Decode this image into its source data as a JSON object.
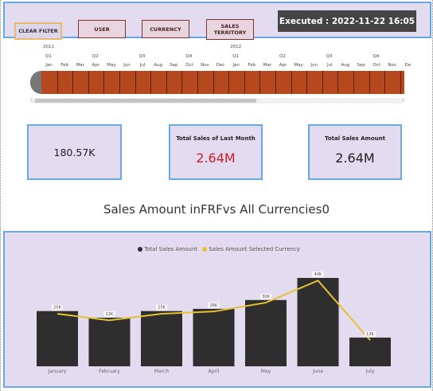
{
  "header": {
    "buttons": {
      "clear_filter": "CLEAR FILTER",
      "user": "USER",
      "currency": "CURRENCY",
      "sales_territory": "SALES TERRITORY"
    },
    "executed": "Executed : 2022-11-22 16:05"
  },
  "timeline": {
    "years": [
      {
        "label": "2011",
        "index": 0
      },
      {
        "label": "2012",
        "index": 12
      }
    ],
    "quarters": [
      {
        "label": "Q1",
        "index": 0
      },
      {
        "label": "Q2",
        "index": 3
      },
      {
        "label": "Q3",
        "index": 6
      },
      {
        "label": "Q4",
        "index": 9
      },
      {
        "label": "Q1",
        "index": 12
      },
      {
        "label": "Q2",
        "index": 15
      },
      {
        "label": "Q3",
        "index": 18
      },
      {
        "label": "Q4",
        "index": 21
      }
    ],
    "months": [
      "Jan",
      "Feb",
      "Mar",
      "Apr",
      "May",
      "Jun",
      "Jul",
      "Aug",
      "Sep",
      "Oct",
      "Nov",
      "Dec",
      "Jan",
      "Feb",
      "Mar",
      "Apr",
      "May",
      "Jun",
      "Jul",
      "Aug",
      "Sep",
      "Oct",
      "Nov",
      "De"
    ],
    "colors": {
      "bar": "#b5491d",
      "divider": "#5b1e08",
      "knob": "#777777"
    }
  },
  "cards": [
    {
      "title": "",
      "value": "180.57K"
    },
    {
      "title": "Total Sales of Last Month",
      "value": "2.64M",
      "value_color": "#c72027"
    },
    {
      "title": "Total Sales Amount",
      "value": "2.64M"
    }
  ],
  "chart_heading": "Sales Amount inFRFvs All Currencies0",
  "chart_data": {
    "type": "bar",
    "categories": [
      "January",
      "February",
      "March",
      "April",
      "May",
      "June",
      "July"
    ],
    "series": [
      {
        "name": "Total Sales Amount",
        "kind": "bar",
        "color": "#2e2e2e",
        "values": [
          25,
          22,
          25,
          26,
          30,
          40,
          13
        ]
      },
      {
        "name": "Sales Amount Selected Currency",
        "kind": "line",
        "color": "#e6c132",
        "values": [
          25,
          22,
          25,
          26,
          30,
          40,
          13
        ]
      }
    ],
    "data_labels": [
      "25K",
      "22K",
      "25K",
      "26K",
      "30K",
      "40K",
      "13K"
    ],
    "ylim": [
      0,
      40
    ]
  }
}
